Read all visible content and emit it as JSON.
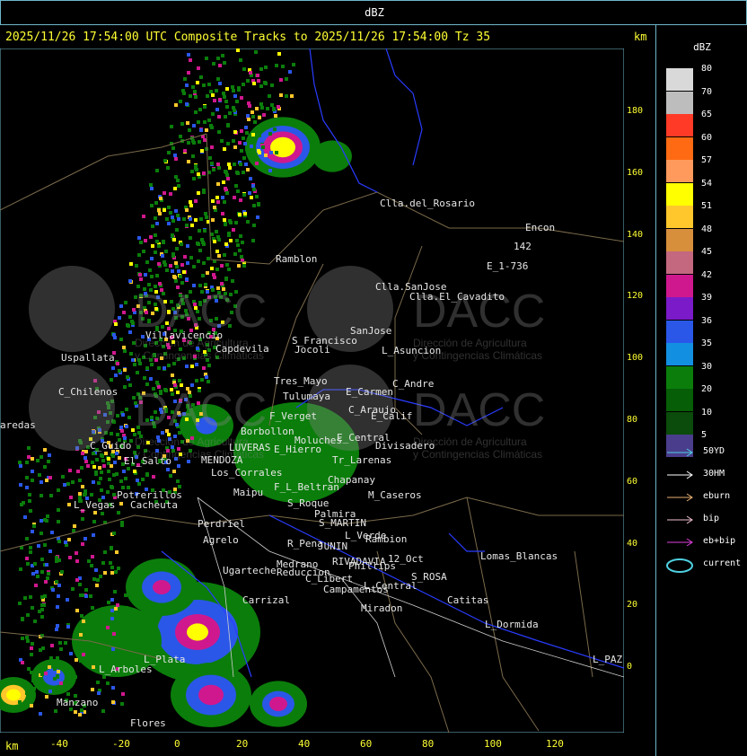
{
  "top_title": "dBZ",
  "header": "2025/11/26 17:54:00 UTC Composite Tracks to 2025/11/26 17:54:00 Tz 35",
  "km_label": "km",
  "legend": {
    "title": "dBZ",
    "scale": [
      {
        "label": "80",
        "color": "#d9d9d9"
      },
      {
        "label": "70",
        "color": "#bdbdbd"
      },
      {
        "label": "65",
        "color": "#ff3a26"
      },
      {
        "label": "60",
        "color": "#ff6a12"
      },
      {
        "label": "57",
        "color": "#ff9a5c"
      },
      {
        "label": "54",
        "color": "#ffff00"
      },
      {
        "label": "51",
        "color": "#ffc72b"
      },
      {
        "label": "48",
        "color": "#d88f3c"
      },
      {
        "label": "45",
        "color": "#c4687f"
      },
      {
        "label": "42",
        "color": "#d0188e"
      },
      {
        "label": "39",
        "color": "#7a1ac8"
      },
      {
        "label": "36",
        "color": "#2a57e8"
      },
      {
        "label": "35",
        "color": "#138fe2"
      },
      {
        "label": "30",
        "color": "#0b7d0b"
      },
      {
        "label": "20",
        "color": "#065e06"
      },
      {
        "label": "10",
        "color": "#0b4b0b"
      },
      {
        "label": "5",
        "color": "#4a3d8c"
      }
    ],
    "tracks": [
      {
        "label": "50YD",
        "color": "#4fd0e0",
        "icon": "arrow-icon"
      },
      {
        "label": "30HM",
        "color": "#ffffff",
        "icon": "arrow-icon"
      },
      {
        "label": "eburn",
        "color": "#e8b070",
        "icon": "arrow-icon"
      },
      {
        "label": "bip",
        "color": "#f0c0d0",
        "icon": "arrow-icon"
      },
      {
        "label": "eb+bip",
        "color": "#e040e0",
        "icon": "arrow-icon"
      },
      {
        "label": "current",
        "color": "#4fd0e0",
        "icon": "ellipse-icon"
      }
    ]
  },
  "y_ticks": [
    "180",
    "160",
    "140",
    "120",
    "100",
    "80",
    "60",
    "40",
    "20",
    "0"
  ],
  "x_ticks": [
    "-40",
    "-20",
    "0",
    "20",
    "40",
    "60",
    "80",
    "100",
    "120"
  ],
  "places": [
    "Clla.del_Rosario",
    "Encon",
    "142",
    "E_1-736",
    "Ramblon",
    "Clla.SanJose",
    "Clla.El_Cavadito",
    "Uspallata",
    "Villavicencio",
    "Capdevila",
    "S_Francisco",
    "Jocoli",
    "SanJose",
    "L_Asuncion",
    "C_Chilenos",
    "Tres_Mayo",
    "Tulumaya",
    "C_Andre",
    "E_Carmen",
    "C_Araujo",
    "E_Calif",
    "aredas",
    "Borbollon",
    "F_Verget",
    "Moluches",
    "E_Central",
    "Divisadero",
    "C_Guido",
    "El_Salto",
    "MENDOZA",
    "LUVERAS",
    "Los_Corrales",
    "E_Hierro",
    "Tr_Larenas",
    "Maipu",
    "Chapanay",
    "Potrerillos",
    "L_Vegas",
    "Cacheuta",
    "F_L_Beltran",
    "Palmira",
    "M_Caseros",
    "Perdriel",
    "S_Roque",
    "Agrelo",
    "S_MARTIN",
    "L_Verde",
    "R_Pena",
    "JUNIN",
    "Rambion",
    "Ugarteche",
    "Medrano",
    "RIVADAVIA",
    "Phillips",
    "12_Oct",
    "S_ROSA",
    "Lomas_Blancas",
    "Carrizal",
    "Reduccion",
    "C_Libert",
    "Campamentos",
    "L_Central",
    "Catitas",
    "Miradon",
    "L_Dormida",
    "L_Plata",
    "L_Arboles",
    "Manzano",
    "Flores",
    "L_PAZ"
  ],
  "watermark": {
    "logo_text": "DACC",
    "subtitle_line1": "Dirección de Agricultura",
    "subtitle_line2": "y Contingencias Climáticas"
  }
}
